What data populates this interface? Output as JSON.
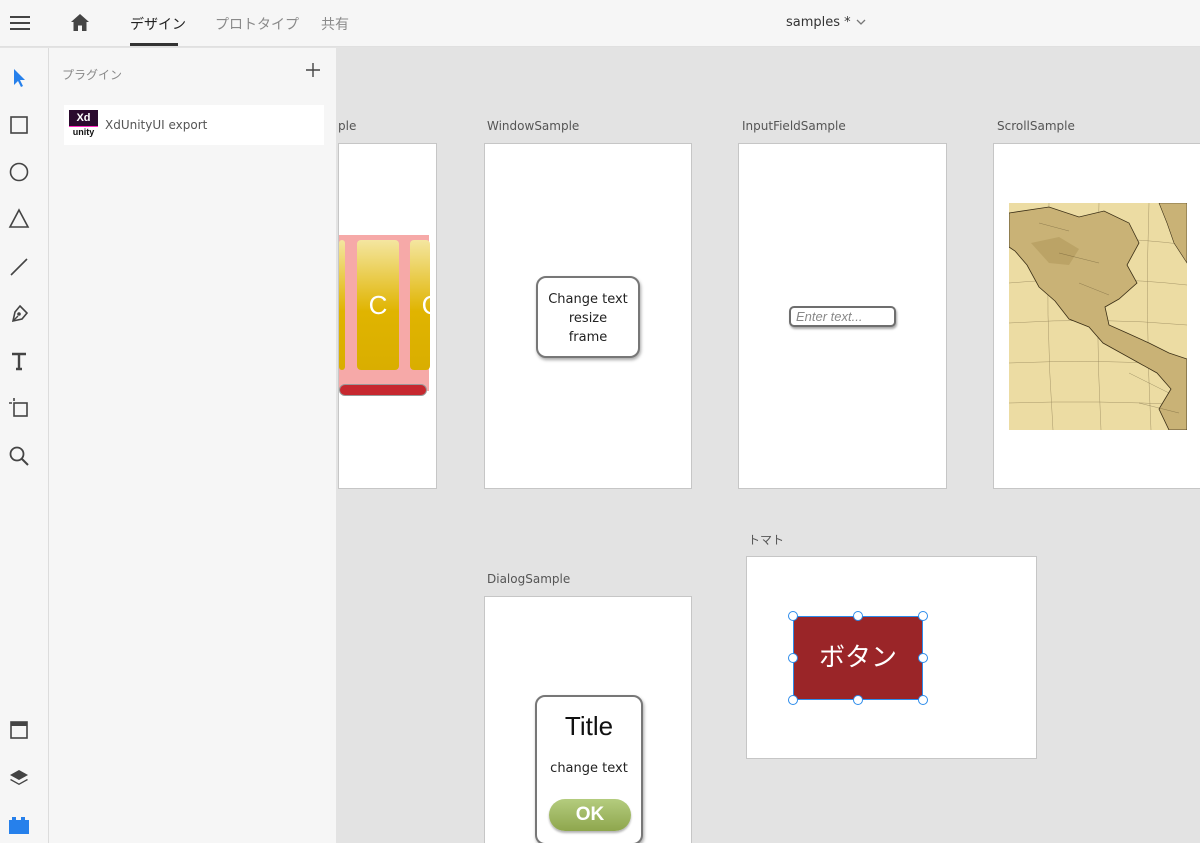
{
  "topbar": {
    "tabs": [
      {
        "label": "デザイン",
        "active": true
      },
      {
        "label": "プロトタイプ",
        "active": false
      },
      {
        "label": "共有",
        "active": false
      }
    ],
    "document_title": "samples *"
  },
  "toolbar": {
    "tools": [
      "select-icon",
      "rectangle-icon",
      "ellipse-icon",
      "polygon-icon",
      "line-icon",
      "pen-icon",
      "text-icon",
      "artboard-icon",
      "zoom-icon"
    ],
    "bottom": [
      "assets-icon",
      "layers-icon",
      "plugins-icon"
    ],
    "accent_color": "#2680eb"
  },
  "panel": {
    "title": "プラグイン",
    "plugins": [
      {
        "name": "XdUnityUI export",
        "logo_top": "Xd",
        "logo_bottom": "unity"
      }
    ]
  },
  "artboards": {
    "partial": {
      "label": "ple",
      "card_letters": [
        "C",
        "C"
      ]
    },
    "window": {
      "label": "WindowSample",
      "frame_text": [
        "Change text",
        "resize",
        "frame"
      ]
    },
    "input": {
      "label": "InputFieldSample",
      "placeholder": "Enter text..."
    },
    "scroll": {
      "label": "ScrollSample"
    },
    "dialog": {
      "label": "DialogSample",
      "title": "Title",
      "text": "change text",
      "ok": "OK"
    },
    "tomato": {
      "label": "トマト",
      "button": "ボタン",
      "button_color": "#9a2528"
    }
  }
}
